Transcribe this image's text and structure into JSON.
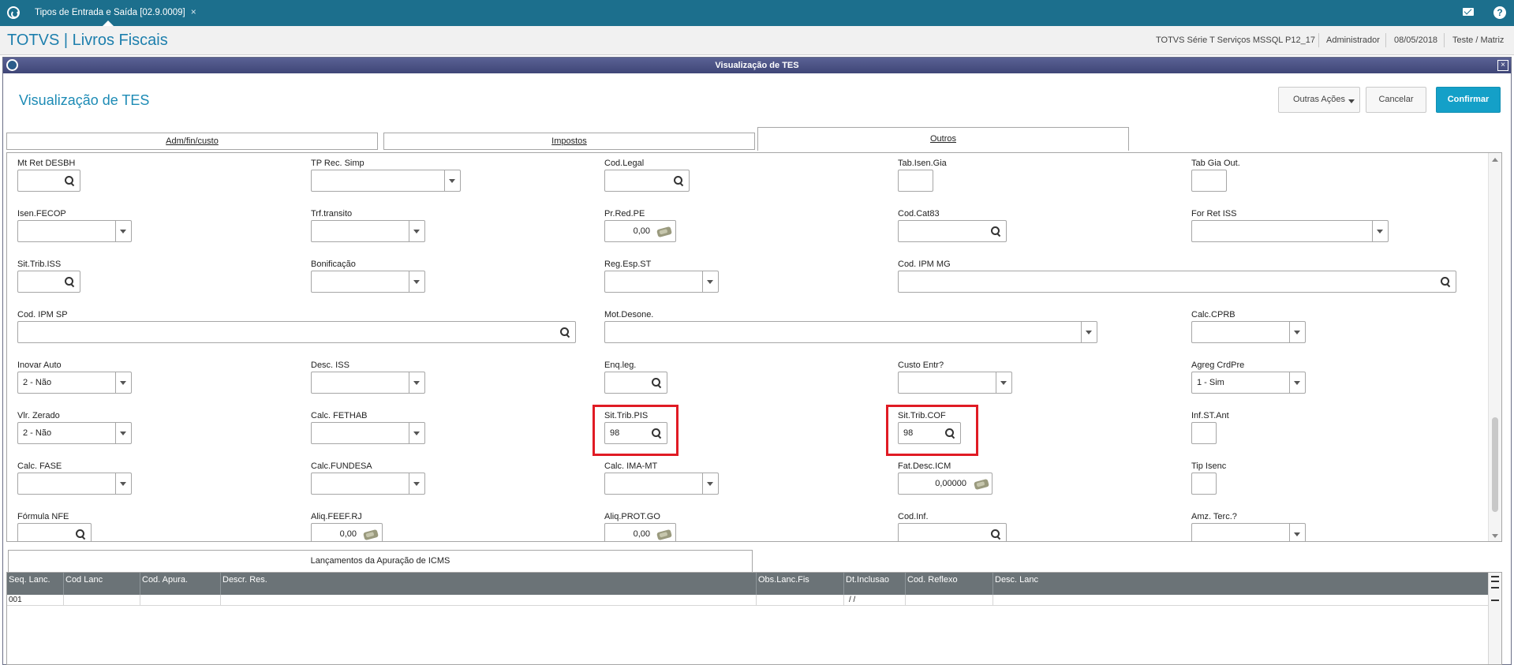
{
  "topbar": {
    "tab_title": "Tipos de Entrada e Saída [02.9.0009]",
    "tab_close": "×"
  },
  "header": {
    "brand": "TOTVS | Livros Fiscais",
    "environment": "TOTVS Série T Serviços MSSQL P12_17",
    "user": "Administrador",
    "date": "08/05/2018",
    "company": "Teste / Matriz"
  },
  "dialog": {
    "window_title": "Visualização de TES",
    "heading": "Visualização de TES",
    "close": "×",
    "buttons": {
      "other_actions": "Outras Ações",
      "cancel": "Cancelar",
      "confirm": "Confirmar"
    }
  },
  "tabs": [
    {
      "label": "Adm/fin/custo",
      "active": false
    },
    {
      "label": "Impostos",
      "active": false
    },
    {
      "label": "Outros",
      "active": true
    }
  ],
  "fields": {
    "mt_ret_desbh": {
      "label": "Mt Ret DESBH",
      "value": ""
    },
    "tp_rec_simp": {
      "label": "TP Rec. Simp",
      "value": ""
    },
    "cod_legal": {
      "label": "Cod.Legal",
      "value": ""
    },
    "tab_isen_gia": {
      "label": "Tab.Isen.Gia",
      "value": ""
    },
    "tab_gia_out": {
      "label": "Tab Gia Out.",
      "value": ""
    },
    "isen_fecop": {
      "label": "Isen.FECOP",
      "value": ""
    },
    "trf_transito": {
      "label": "Trf.transito",
      "value": ""
    },
    "pr_red_pe": {
      "label": "Pr.Red.PE",
      "value": "0,00"
    },
    "cod_cat83": {
      "label": "Cod.Cat83",
      "value": ""
    },
    "for_ret_iss": {
      "label": "For Ret ISS",
      "value": ""
    },
    "sit_trib_iss": {
      "label": "Sit.Trib.ISS",
      "value": ""
    },
    "bonificacao": {
      "label": "Bonificação",
      "value": ""
    },
    "reg_esp_st": {
      "label": "Reg.Esp.ST",
      "value": ""
    },
    "cod_ipm_mg": {
      "label": "Cod. IPM MG",
      "value": ""
    },
    "cod_ipm_sp": {
      "label": "Cod. IPM SP",
      "value": ""
    },
    "mot_desone": {
      "label": "Mot.Desone.",
      "value": ""
    },
    "calc_cprb": {
      "label": "Calc.CPRB",
      "value": ""
    },
    "inovar_auto": {
      "label": "Inovar Auto",
      "value": "2 - Não"
    },
    "desc_iss": {
      "label": "Desc. ISS",
      "value": ""
    },
    "enq_leg": {
      "label": "Enq.leg.",
      "value": ""
    },
    "custo_entr": {
      "label": "Custo Entr?",
      "value": ""
    },
    "agreg_crdpre": {
      "label": "Agreg CrdPre",
      "value": "1 - Sim"
    },
    "vlr_zerado": {
      "label": "Vlr. Zerado",
      "value": "2 - Não"
    },
    "calc_fethab": {
      "label": "Calc. FETHAB",
      "value": ""
    },
    "sit_trib_pis": {
      "label": "Sit.Trib.PIS",
      "value": "98"
    },
    "sit_trib_cof": {
      "label": "Sit.Trib.COF",
      "value": "98"
    },
    "inf_st_ant": {
      "label": "Inf.ST.Ant",
      "value": ""
    },
    "calc_fase": {
      "label": "Calc. FASE",
      "value": ""
    },
    "calc_fundesa": {
      "label": "Calc.FUNDESA",
      "value": ""
    },
    "calc_ima_mt": {
      "label": "Calc. IMA-MT",
      "value": ""
    },
    "fat_desc_icm": {
      "label": "Fat.Desc.ICM",
      "value": "0,00000"
    },
    "tip_isenc": {
      "label": "Tip Isenc",
      "value": ""
    },
    "formula_nfe": {
      "label": "Fórmula NFE",
      "value": ""
    },
    "aliq_feef_rj": {
      "label": "Aliq.FEEF.RJ",
      "value": "0,00"
    },
    "aliq_prot_go": {
      "label": "Aliq.PROT.GO",
      "value": "0,00"
    },
    "cod_inf": {
      "label": "Cod.Inf.",
      "value": ""
    },
    "amz_terc": {
      "label": "Amz. Terc.?",
      "value": ""
    }
  },
  "lower_tab": {
    "label": "Lançamentos da Apuração de ICMS"
  },
  "grid": {
    "columns": [
      "Seq. Lanc.",
      "Cod Lanc",
      "Cod. Apura.",
      "Descr. Res.",
      "Obs.Lanc.Fis",
      "Dt.Inclusao",
      "Cod. Reflexo",
      "Desc. Lanc"
    ],
    "rows": [
      [
        "001",
        "",
        "",
        "",
        "",
        " /  /",
        "",
        ""
      ]
    ]
  },
  "colors": {
    "topbar": "#1c6f8d",
    "brand": "#1d7fad",
    "confirm": "#14a0c8",
    "highlight": "#e01b24"
  }
}
